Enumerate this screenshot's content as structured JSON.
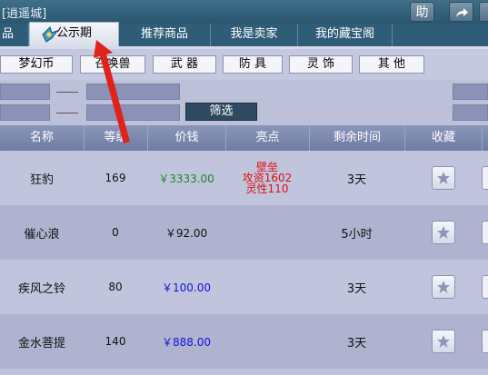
{
  "window": {
    "title": "[逍遥城]",
    "help_label": "助"
  },
  "tabs": [
    {
      "label": "品",
      "active": false
    },
    {
      "label": "公示期",
      "active": true
    },
    {
      "label": "推荐商品",
      "active": false
    },
    {
      "label": "我是卖家",
      "active": false
    },
    {
      "label": "我的藏宝阁",
      "active": false
    }
  ],
  "categories": [
    "梦幻币",
    "召唤兽",
    "武 器",
    "防 具",
    "灵 饰",
    "其 他"
  ],
  "filter": {
    "button_label": "筛选"
  },
  "table": {
    "headers": [
      "名称",
      "等级",
      "价钱",
      "亮点",
      "剩余时间",
      "收藏"
    ],
    "rows": [
      {
        "name": "狂豹",
        "level": "169",
        "price": "￥3333.00",
        "price_color": "#1a8a2a",
        "highlights": [
          "壁垒",
          "攻资1602",
          "灵性110"
        ],
        "time": "3天"
      },
      {
        "name": "催心浪",
        "level": "0",
        "price": "￥92.00",
        "price_color": "#111111",
        "highlights": [],
        "time": "5小时"
      },
      {
        "name": "疾风之铃",
        "level": "80",
        "price": "￥100.00",
        "price_color": "#1414d8",
        "highlights": [],
        "time": "3天"
      },
      {
        "name": "金水菩提",
        "level": "140",
        "price": "￥888.00",
        "price_color": "#1414d8",
        "highlights": [],
        "time": "3天"
      }
    ]
  },
  "icons": {
    "favorite": "star-icon",
    "share": "share-arrow-icon",
    "annotation": "red-arrow-annotation"
  },
  "colors": {
    "accent": "#2f5d78",
    "highlight_red": "#e01010"
  }
}
